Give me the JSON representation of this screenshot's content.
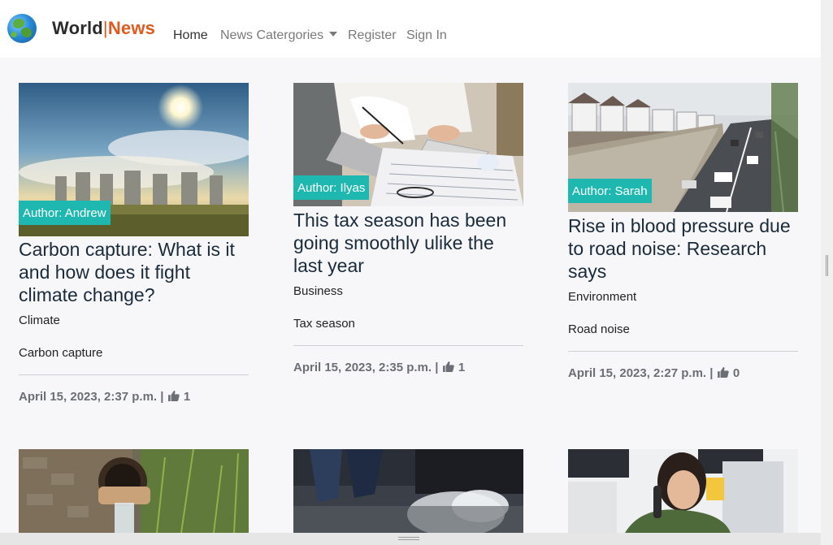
{
  "brand": {
    "part1": "World",
    "separator": "|",
    "part2": "News",
    "logo_icon": "globe-icon"
  },
  "nav": {
    "home": "Home",
    "categories": "News Catergories",
    "register": "Register",
    "signin": "Sign In"
  },
  "cards": [
    {
      "author": "Author: Andrew",
      "title": "Carbon capture: What is it and how does it fight climate change?",
      "category": "Climate",
      "tag": "Carbon capture",
      "date": "April 15, 2023, 2:37 p.m.",
      "separator": "|",
      "likes": "1",
      "like_icon": "thumbs-up-icon"
    },
    {
      "author": "Author: Ilyas",
      "title": "This tax season has been going smoothly ulike the last year",
      "category": "Business",
      "tag": "Tax season",
      "date": "April 15, 2023, 2:35 p.m.",
      "separator": "|",
      "likes": "1",
      "like_icon": "thumbs-up-icon"
    },
    {
      "author": "Author: Sarah",
      "title": "Rise in blood pressure due to road noise: Research says",
      "category": "Environment",
      "tag": "Road noise",
      "date": "April 15, 2023, 2:27 p.m.",
      "separator": "|",
      "likes": "0",
      "like_icon": "thumbs-up-icon"
    }
  ],
  "colors": {
    "accent": "#1fb8b0",
    "brand_news": "#e05a1e",
    "title": "#1a2b3c"
  }
}
